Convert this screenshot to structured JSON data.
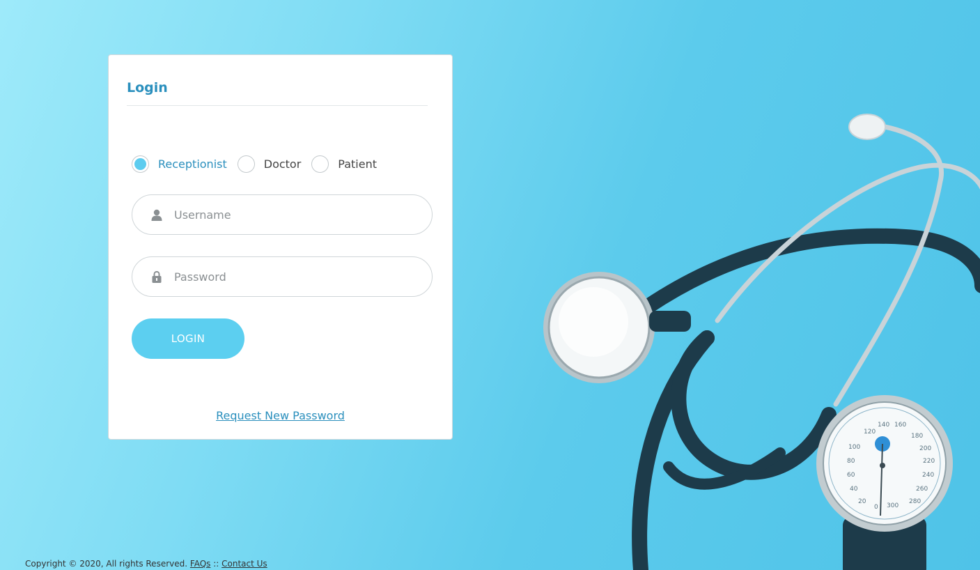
{
  "login": {
    "title": "Login",
    "roles": [
      {
        "label": "Receptionist",
        "checked": true
      },
      {
        "label": "Doctor",
        "checked": false
      },
      {
        "label": "Patient",
        "checked": false
      }
    ],
    "username": {
      "placeholder": "Username",
      "value": "",
      "icon": "user-icon"
    },
    "password": {
      "placeholder": "Password",
      "value": "",
      "icon": "lock-icon"
    },
    "submit_label": "LOGIN",
    "request_password_label": "Request New Password"
  },
  "footer": {
    "copyright": "Copyright © 2020, All rights Reserved.",
    "faqs_label": "FAQs",
    "separator": "::",
    "contact_label": "Contact Us"
  },
  "colors": {
    "accent": "#2a8fbd",
    "button": "#5ccff0",
    "background": "#5ccbec"
  }
}
